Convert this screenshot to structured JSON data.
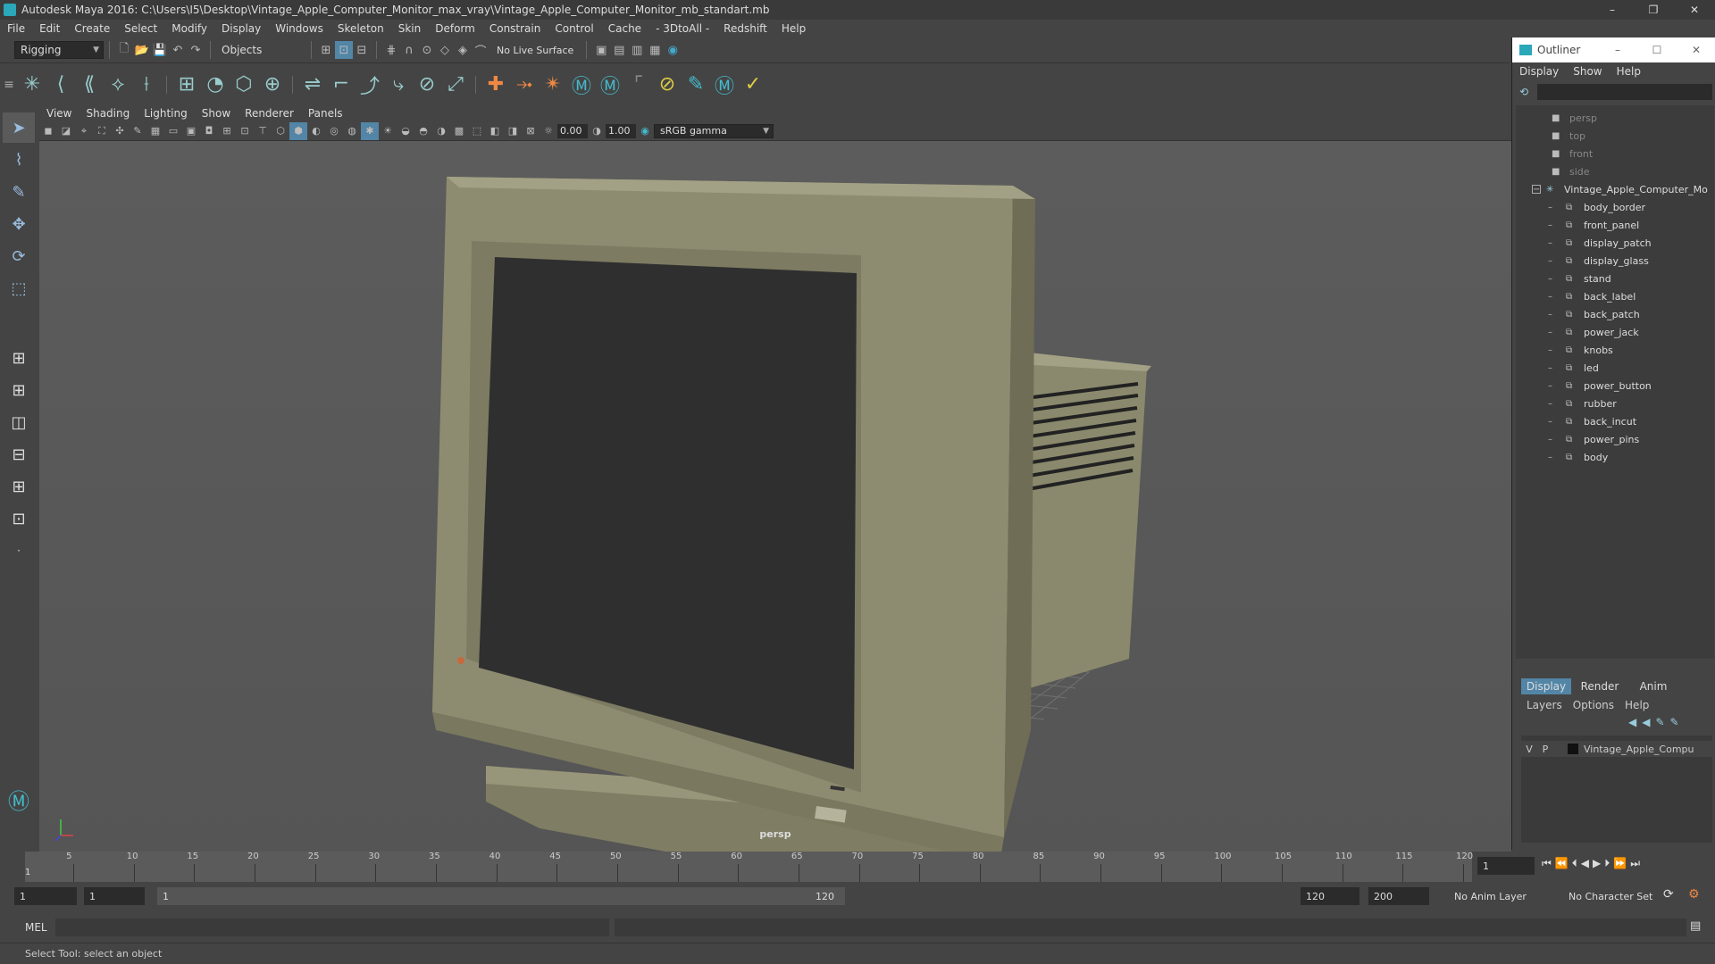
{
  "window": {
    "title": "Autodesk Maya 2016: C:\\Users\\I5\\Desktop\\Vintage_Apple_Computer_Monitor_max_vray\\Vintage_Apple_Computer_Monitor_mb_standart.mb",
    "minimize": "–",
    "restore": "❐",
    "close": "✕"
  },
  "menubar": [
    "File",
    "Edit",
    "Create",
    "Select",
    "Modify",
    "Display",
    "Windows",
    "Skeleton",
    "Skin",
    "Deform",
    "Constrain",
    "Control",
    "Cache",
    "- 3DtoAll -",
    "Redshift",
    "Help"
  ],
  "statusline": {
    "mode": "Rigging",
    "selection_mask": "Objects",
    "live_surface": "No Live Surface"
  },
  "viewport": {
    "menu": [
      "View",
      "Shading",
      "Lighting",
      "Show",
      "Renderer",
      "Panels"
    ],
    "near_value": "0.00",
    "far_value": "1.00",
    "color_space": "sRGB gamma",
    "camera_label": "persp"
  },
  "outliner": {
    "title": "Outliner",
    "menu": [
      "Display",
      "Show",
      "Help"
    ],
    "cameras": [
      "persp",
      "top",
      "front",
      "side"
    ],
    "root": "Vintage_Apple_Computer_Mo",
    "children": [
      "body_border",
      "front_panel",
      "display_patch",
      "display_glass",
      "stand",
      "back_label",
      "back_patch",
      "power_jack",
      "knobs",
      "led",
      "power_button",
      "rubber",
      "back_incut",
      "power_pins",
      "body"
    ]
  },
  "layers": {
    "tabs": [
      "Display",
      "Render",
      "Anim"
    ],
    "menu": [
      "Layers",
      "Options",
      "Help"
    ],
    "layer_v": "V",
    "layer_p": "P",
    "layer_name": "Vintage_Apple_Compu"
  },
  "timeline": {
    "ticks": [
      "5",
      "10",
      "15",
      "20",
      "25",
      "30",
      "35",
      "40",
      "45",
      "50",
      "55",
      "60",
      "65",
      "70",
      "75",
      "80",
      "85",
      "90",
      "95",
      "100",
      "105",
      "110",
      "115",
      "120"
    ],
    "start_marker": "1",
    "current_frame": "1"
  },
  "range": {
    "start": "1",
    "start_inner": "1",
    "slider_start": "1",
    "slider_end": "120",
    "end_inner": "120",
    "end": "200",
    "anim_layer": "No Anim Layer",
    "character_set": "No Character Set"
  },
  "cmdline": {
    "label": "MEL"
  },
  "helpline": {
    "text": "Select Tool: select an object"
  },
  "colors": {
    "accent": "#5285a6",
    "model": "#8c8a6e"
  }
}
